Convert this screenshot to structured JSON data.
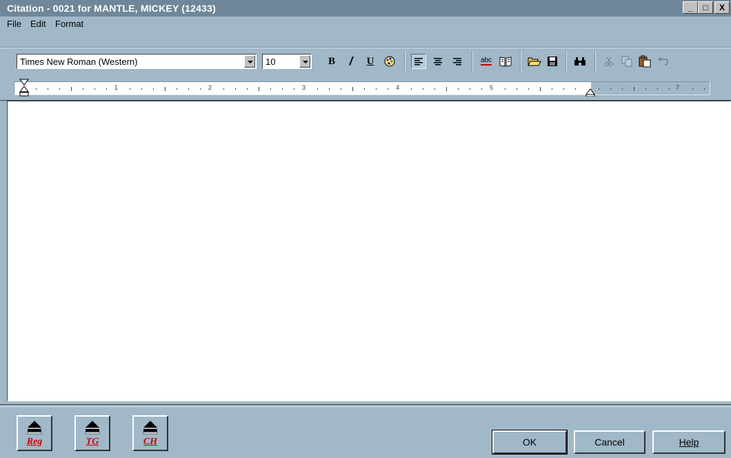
{
  "window": {
    "title": "Citation - 0021 for  MANTLE, MICKEY (12433)"
  },
  "window_buttons": {
    "minimize": "_",
    "maximize": "□",
    "close": "X"
  },
  "menu": {
    "items": [
      "File",
      "Edit",
      "Format"
    ]
  },
  "toolbar": {
    "font": "Times New Roman (Western)",
    "size": "10",
    "bold": "B",
    "italic": "/",
    "underline": "U",
    "spell_icon_text": "abc"
  },
  "ruler": {
    "numbers": [
      "1",
      "2",
      "3",
      "4",
      "5",
      "7"
    ]
  },
  "editor": {
    "content": ""
  },
  "report_buttons": [
    "Reg",
    "TG",
    "CH"
  ],
  "buttons": {
    "ok": "OK",
    "cancel": "Cancel",
    "help": "Help"
  },
  "colors": {
    "background": "#a0b8c8",
    "titlebar": "#6f879a",
    "report_label": "#d00000"
  }
}
